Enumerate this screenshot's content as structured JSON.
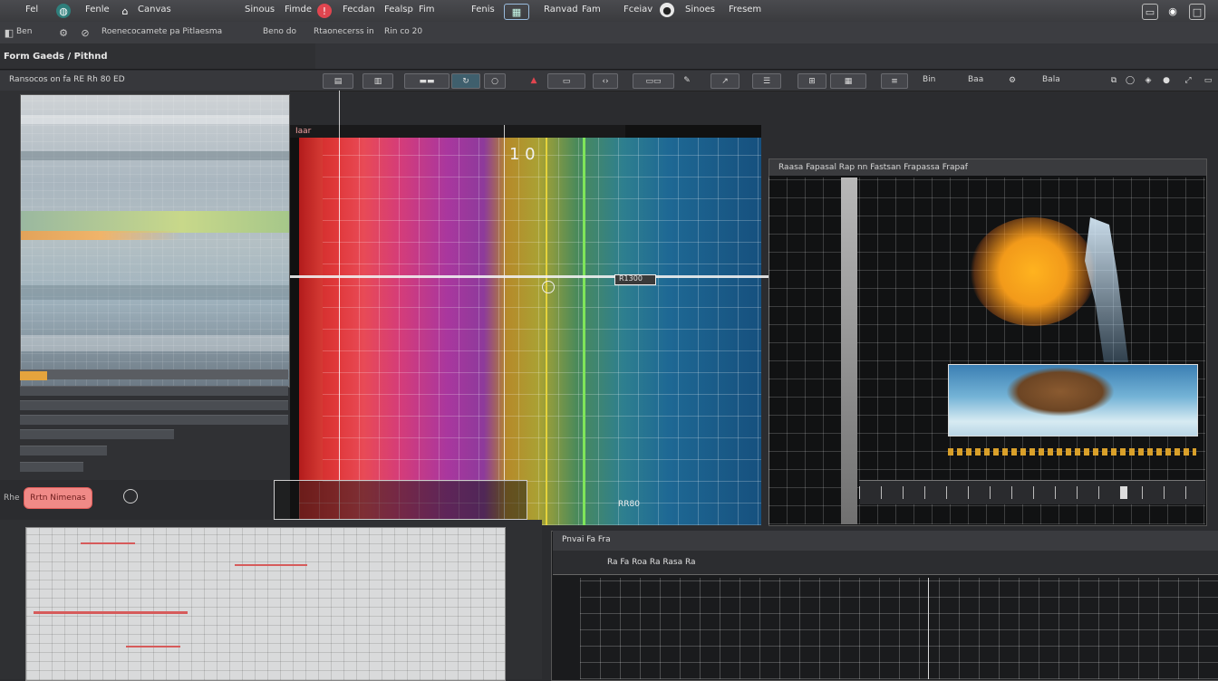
{
  "menubar": {
    "items": [
      "Fel",
      "Fenle",
      "Canvas",
      "Sinous",
      "Fimde",
      "Fecdan",
      "Fealsp",
      "Fim",
      "Fenis",
      "Ranvad",
      "Fam",
      "Fceiav",
      "Sinoes",
      "Fresem"
    ]
  },
  "toolbar2": {
    "items": [
      "Ben",
      "Roenecocamete pa Pitlaesma",
      "Beno do",
      "Rtaonecerss in",
      "Rin co 20"
    ]
  },
  "pathbar": {
    "label": "Form Gaeds / Pithnd"
  },
  "toolbar3": {
    "left_label": "Ransocos on fa RE Rh 80 ED",
    "items": [
      "Bin",
      "Baa",
      "Bala"
    ]
  },
  "canvas": {
    "header_label": "Iaar",
    "cursor_label": "1 0",
    "crosshair_label": "R1300",
    "bottom_label": "RR80"
  },
  "right_panel": {
    "header_label": "Raasa Fapasal Rap nn Fastsan Frapassa Frapaf"
  },
  "bottom_left": {
    "button_label": "Rrtn Nimenas",
    "side_label": "Rhe"
  },
  "bottom_right": {
    "toolbar_label": "Pnvai Fa Fra",
    "status_label": "Ra Fa Roa Ra Rasa Ra"
  },
  "colors": {
    "accent_red": "#d53a34",
    "accent_green": "#7fe55a",
    "accent_yellow": "#e6d33b",
    "accent_orange": "#f29a1a",
    "panel_bg": "#2b2c2f"
  }
}
